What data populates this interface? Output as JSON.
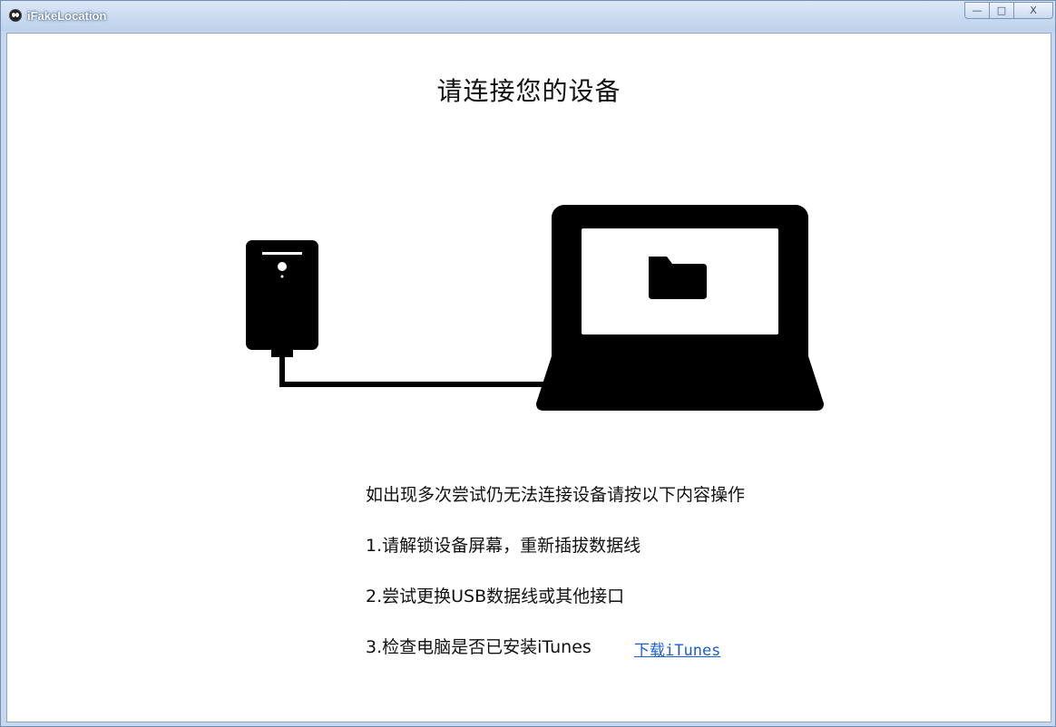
{
  "window": {
    "title": "iFakeLocation",
    "controls": {
      "minimize": "—",
      "maximize": "□",
      "close": "X"
    }
  },
  "main": {
    "heading": "请连接您的设备",
    "instructions": [
      "如出现多次尝试仍无法连接设备请按以下内容操作",
      "1.请解锁设备屏幕，重新插拔数据线",
      "2.尝试更换USB数据线或其他接口",
      "3.检查电脑是否已安装iTunes"
    ],
    "download_link": "下载iTunes"
  },
  "colors": {
    "titlebar": "#bcd1ec",
    "link": "#1a5fd8",
    "illustration": "#000000"
  }
}
